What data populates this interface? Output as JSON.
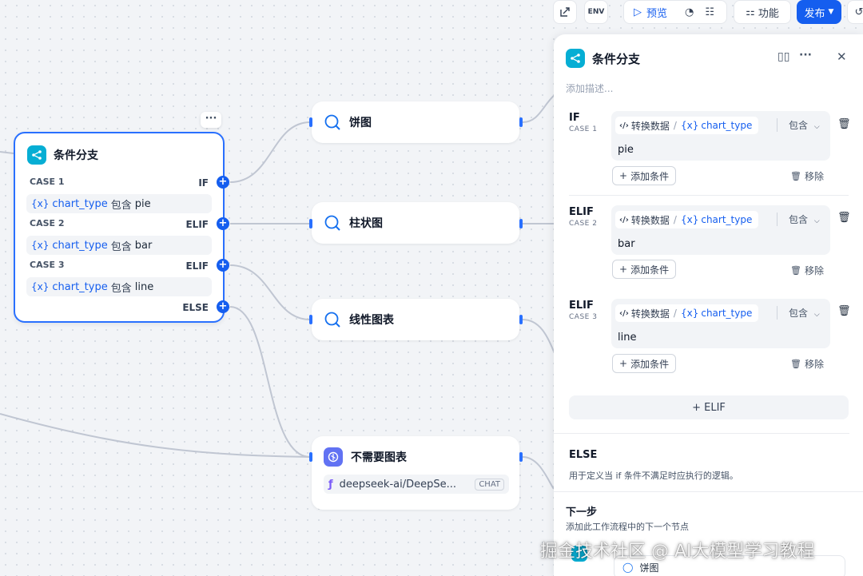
{
  "toolbar": {
    "preview_label": "预览",
    "features_label": "功能",
    "publish_label": "发布",
    "env_label": "ENV"
  },
  "if_node": {
    "title": "条件分支",
    "cases": [
      {
        "label": "CASE 1",
        "keyword": "IF",
        "var_sym": "{x}",
        "var": "chart_type",
        "op": "包含",
        "value": "pie"
      },
      {
        "label": "CASE 2",
        "keyword": "ELIF",
        "var_sym": "{x}",
        "var": "chart_type",
        "op": "包含",
        "value": "bar"
      },
      {
        "label": "CASE 3",
        "keyword": "ELIF",
        "var_sym": "{x}",
        "var": "chart_type",
        "op": "包含",
        "value": "line"
      }
    ],
    "else_label": "ELSE",
    "more": "···"
  },
  "target_nodes": [
    {
      "title": "饼图"
    },
    {
      "title": "柱状图"
    },
    {
      "title": "线性图表"
    },
    {
      "title": "不需要图表",
      "model": "deepseek-ai/DeepSe...",
      "badge": "CHAT"
    }
  ],
  "panel": {
    "title": "条件分支",
    "description_placeholder": "添加描述...",
    "cases": [
      {
        "keyword": "IF",
        "sub": "CASE 1",
        "source": "转换数据",
        "var_sym": "{x}",
        "var": "chart_type",
        "op": "包含",
        "value": "pie"
      },
      {
        "keyword": "ELIF",
        "sub": "CASE 2",
        "source": "转换数据",
        "var_sym": "{x}",
        "var": "chart_type",
        "op": "包含",
        "value": "bar"
      },
      {
        "keyword": "ELIF",
        "sub": "CASE 3",
        "source": "转换数据",
        "var_sym": "{x}",
        "var": "chart_type",
        "op": "包含",
        "value": "line"
      }
    ],
    "add_condition_label": "添加条件",
    "remove_label": "移除",
    "add_elif_label": "+ ELIF",
    "else_title": "ELSE",
    "else_desc": "用于定义当 if 条件不满足时应执行的逻辑。",
    "next_title": "下一步",
    "next_desc": "添加此工作流程中的下一个节点",
    "next_node": "饼图"
  },
  "watermark": "掘金技术社区 @ AI大模型学习教程"
}
